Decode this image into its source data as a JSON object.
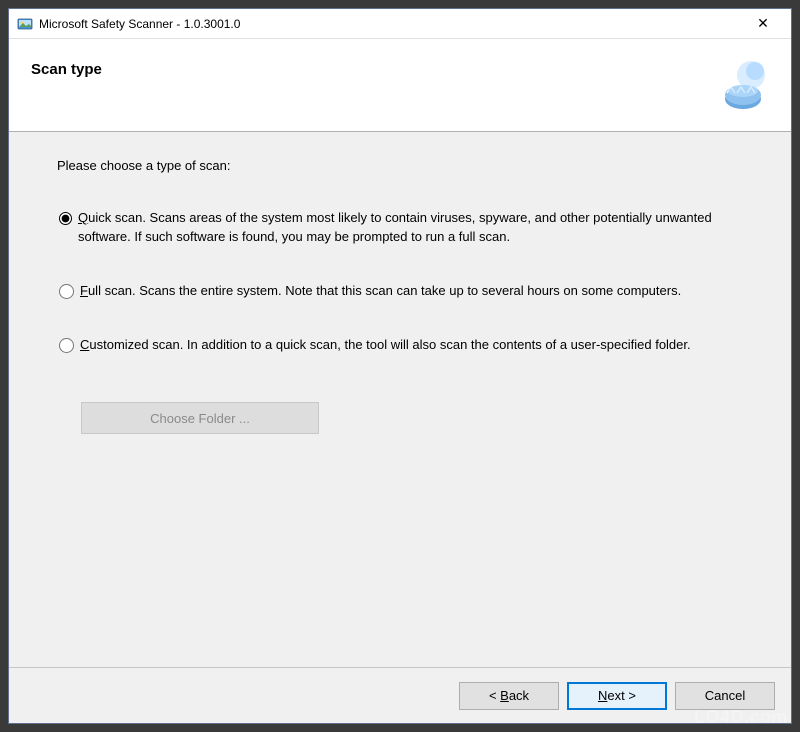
{
  "titlebar": {
    "title": "Microsoft Safety Scanner - 1.0.3001.0",
    "close_glyph": "✕"
  },
  "header": {
    "title": "Scan type"
  },
  "content": {
    "instruction": "Please choose a type of scan:",
    "options": [
      {
        "mnemonic": "Q",
        "rest": "uick scan. Scans areas of the system most likely to contain viruses, spyware, and other potentially unwanted software. If such software is found, you may be prompted to run a full scan.",
        "checked": true
      },
      {
        "mnemonic": "F",
        "rest": "ull scan. Scans the entire system. Note that this scan can take up to several hours on some computers.",
        "checked": false
      },
      {
        "mnemonic": "C",
        "rest": "ustomized scan. In addition to a quick scan, the tool will also scan the contents of a user-specified folder.",
        "checked": false
      }
    ],
    "choose_folder_label": "Choose Folder ..."
  },
  "footer": {
    "back_mnemonic": "B",
    "back_prefix": "< ",
    "back_rest": "ack",
    "next_mnemonic": "N",
    "next_rest": "ext >",
    "cancel_label": "Cancel"
  },
  "watermark": "LO4D.com"
}
